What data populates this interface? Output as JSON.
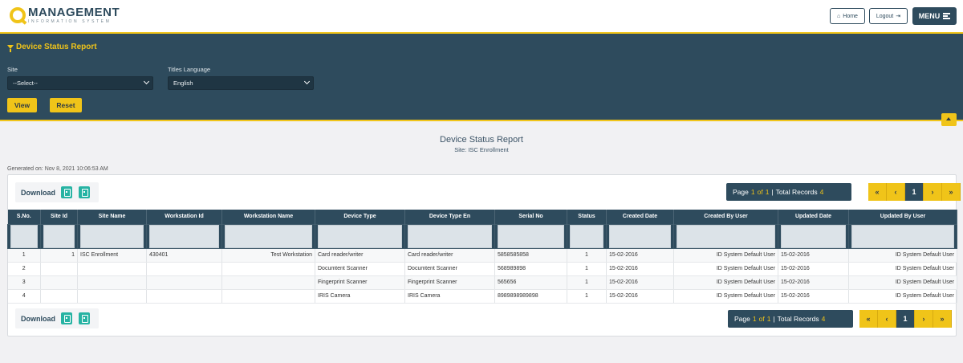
{
  "app": {
    "logo_main": "MANAGEMENT",
    "logo_sub": "INFORMATION SYSTEM",
    "home_label": "Home",
    "logout_label": "Logout",
    "menu_label": "MENU"
  },
  "filter": {
    "title": "Device Status Report",
    "site_label": "Site",
    "site_value": "--Select--",
    "lang_label": "Titles Language",
    "lang_value": "English",
    "view_label": "View",
    "reset_label": "Reset"
  },
  "report": {
    "title": "Device Status Report",
    "site": "Site: ISC Enrollment",
    "generated": "Generated on: Nov 8, 2021 10:06:53 AM"
  },
  "download_label": "Download",
  "pager": {
    "page_word": "Page",
    "page": "1",
    "of_word": "of",
    "total_pages": "1",
    "sep": "|",
    "total_records_label": "Total Records",
    "total_records": "4",
    "first": "«",
    "prev": "‹",
    "current": "1",
    "next": "›",
    "last": "»"
  },
  "table": {
    "headers": [
      "S.No.",
      "Site Id",
      "Site Name",
      "Workstation Id",
      "Workstation Name",
      "Device Type",
      "Device Type En",
      "Serial No",
      "Status",
      "Created Date",
      "Created By User",
      "Updated Date",
      "Updated By User"
    ],
    "rows": [
      [
        "1",
        "1",
        "ISC Enrollment",
        "430401",
        "Test Workstation",
        "Card reader/writer",
        "Card reader/writer",
        "5858585858",
        "1",
        "15-02-2016",
        "ID System Default User",
        "15-02-2016",
        "ID System Default User"
      ],
      [
        "2",
        "",
        "",
        "",
        "",
        "Documtent Scanner",
        "Documtent Scanner",
        "568989898",
        "1",
        "15-02-2016",
        "ID System Default User",
        "15-02-2016",
        "ID System Default User"
      ],
      [
        "3",
        "",
        "",
        "",
        "",
        "Fingerprint Scanner",
        "Fingerprint Scanner",
        "565656",
        "1",
        "15-02-2016",
        "ID System Default User",
        "15-02-2016",
        "ID System Default User"
      ],
      [
        "4",
        "",
        "",
        "",
        "",
        "IRIS Camera",
        "IRIS Camera",
        "8989898989898",
        "1",
        "15-02-2016",
        "ID System Default User",
        "15-02-2016",
        "ID System Default User"
      ]
    ]
  },
  "colors": {
    "primary": "#2e4b5d",
    "accent": "#f0c419",
    "download_icon": "#26b3a3"
  },
  "icons": [
    "logo-q-icon",
    "home-icon",
    "logout-icon",
    "menu-icon",
    "filter-icon",
    "chevron-down-icon",
    "collapse-up-icon",
    "pdf-file-icon",
    "excel-file-icon"
  ]
}
